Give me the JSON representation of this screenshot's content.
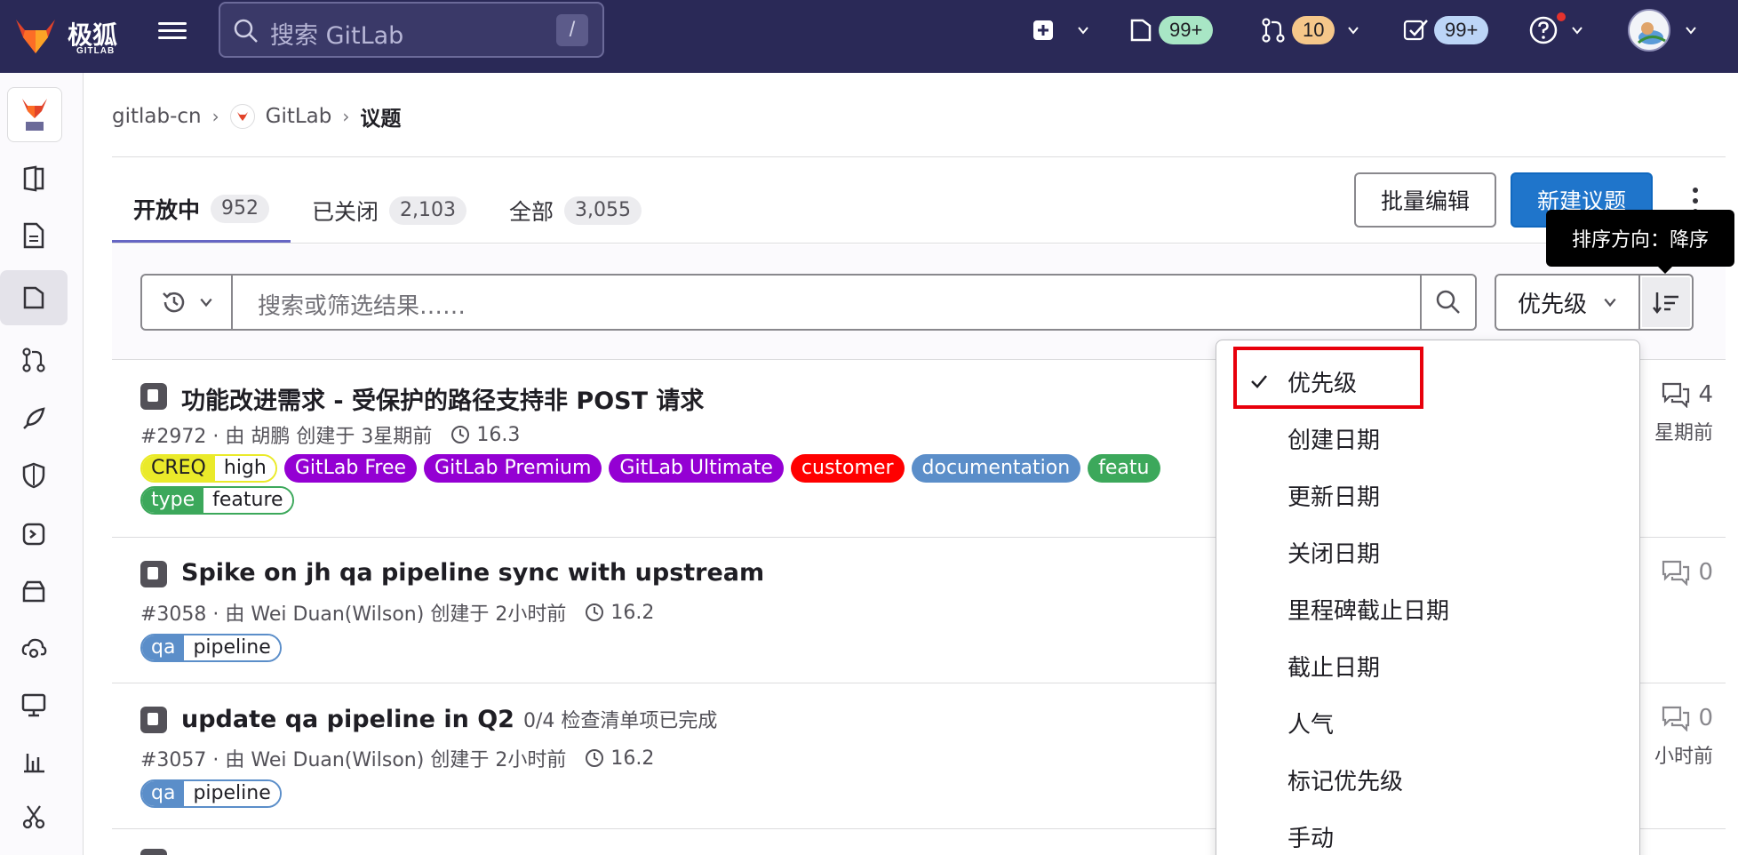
{
  "topbar": {
    "logo_text": "极狐",
    "logo_sub": "GITLAB",
    "search_placeholder": "搜索 GitLab",
    "search_shortcut": "/",
    "issues_count": "99+",
    "mr_count": "10",
    "todos_count": "99+"
  },
  "breadcrumb": {
    "items": [
      "gitlab-cn",
      "GitLab",
      "议题"
    ]
  },
  "tabs": [
    {
      "label": "开放中",
      "count": "952"
    },
    {
      "label": "已关闭",
      "count": "2,103"
    },
    {
      "label": "全部",
      "count": "3,055"
    }
  ],
  "actions": {
    "bulk_edit": "批量编辑",
    "new_issue": "新建议题",
    "tooltip": "排序方向：降序"
  },
  "filter": {
    "placeholder": "搜索或筛选结果……",
    "sort_selected": "优先级"
  },
  "issues": [
    {
      "title": "功能改进需求 - 受保护的路径支持非 POST 请求",
      "subtitle": "",
      "meta": "#2972 · 由 胡鹏 创建于 3星期前",
      "milestone": "16.3",
      "comments": "4",
      "updated": "星期前",
      "labels_row1": [
        {
          "type": "scoped",
          "key": "CREQ",
          "value": "high",
          "color": "#eaea2a"
        },
        {
          "type": "plain",
          "text": "GitLab Free",
          "color": "#9400d3"
        },
        {
          "type": "plain",
          "text": "GitLab Premium",
          "color": "#9400d3"
        },
        {
          "type": "plain",
          "text": "GitLab Ultimate",
          "color": "#9400d3"
        },
        {
          "type": "plain",
          "text": "customer",
          "color": "#ff0000"
        },
        {
          "type": "plain",
          "text": "documentation",
          "color": "#5b8ec9"
        },
        {
          "type": "plain",
          "text": "featu",
          "color": "#3ca85b"
        }
      ],
      "labels_row2": [
        {
          "type": "scoped",
          "key": "type",
          "value": "feature",
          "color": "#3ca85b"
        }
      ]
    },
    {
      "title": "Spike on jh qa pipeline sync with upstream",
      "subtitle": "",
      "meta": "#3058 · 由 Wei Duan(Wilson) 创建于 2小时前",
      "milestone": "16.2",
      "comments": "0",
      "updated": "",
      "labels_row1": [
        {
          "type": "scoped",
          "key": "qa",
          "value": "pipeline",
          "color": "#5b8ec9"
        }
      ]
    },
    {
      "title": "update qa pipeline in Q2",
      "subtitle": "0/4 检查清单项已完成",
      "meta": "#3057 · 由 Wei Duan(Wilson) 创建于 2小时前",
      "milestone": "16.2",
      "comments": "0",
      "updated": "小时前",
      "labels_row1": [
        {
          "type": "scoped",
          "key": "qa",
          "value": "pipeline",
          "color": "#5b8ec9"
        }
      ]
    }
  ],
  "sort_options": [
    "优先级",
    "创建日期",
    "更新日期",
    "关闭日期",
    "里程碑截止日期",
    "截止日期",
    "人气",
    "标记优先级",
    "手动"
  ],
  "colors": {
    "topbar": "#2a2957",
    "primary": "#1f75cb",
    "highlight": "#e8000b"
  }
}
